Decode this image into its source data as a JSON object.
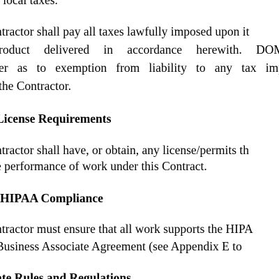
{
  "document": {
    "line_local_taxes": "r local taxes.",
    "taxes_para": {
      "line1": "ntractor shall pay all taxes lawfully imposed upon it",
      "line2_words": [
        "roduct",
        "delivered",
        "in",
        "accordance",
        "herewith.",
        "DOM"
      ],
      "line3_words": [
        "er",
        "as",
        "to",
        "exemption",
        "from",
        "liability",
        "to",
        "any",
        "tax",
        "imp"
      ],
      "line4": "the Contractor."
    },
    "license": {
      "heading": "License Requirements",
      "line1": "ntractor shall have, or obtain, any license/permits th",
      "line2": "e performance of work under this Contract."
    },
    "hipaa": {
      "heading": "HIPAA Compliance",
      "line1": "ntractor must ensure that all work supports the HIPA",
      "line2": "Business Associate Agreement (see Appendix E to"
    },
    "rules": {
      "heading": "ate Rules and Regulations"
    }
  }
}
